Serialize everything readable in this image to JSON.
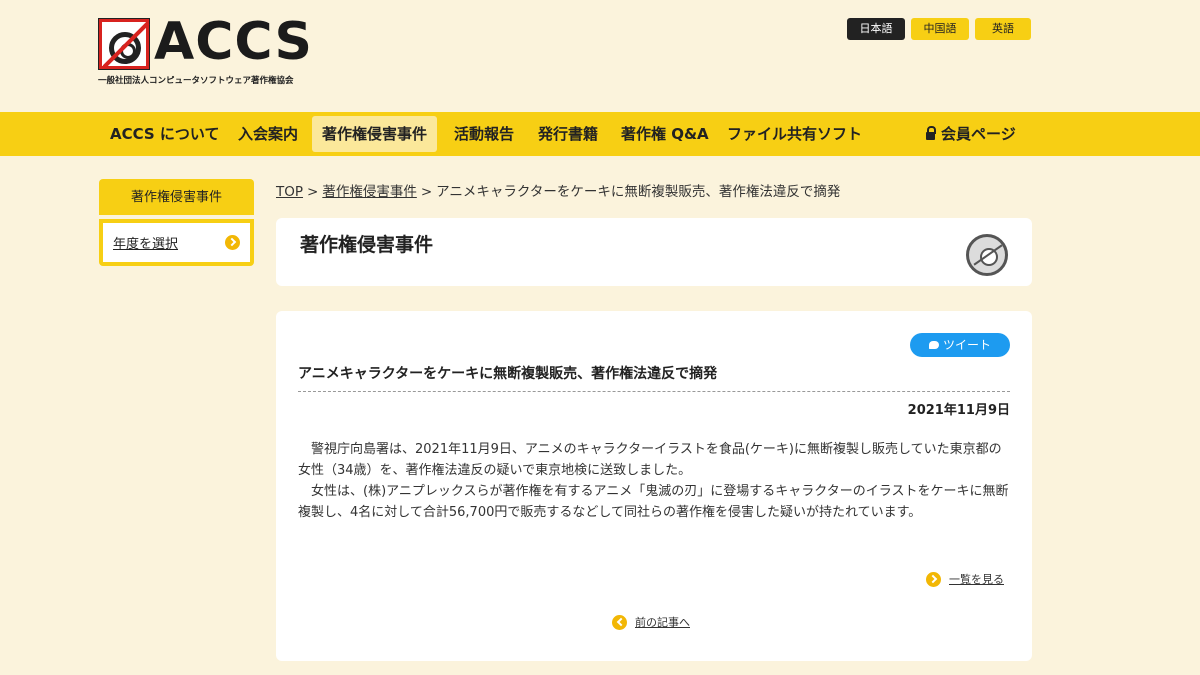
{
  "header": {
    "logo_text": "ACCS",
    "logo_subtitle": "一般社団法人コンピュータソフトウェア著作権協会",
    "languages": [
      {
        "label": "日本語",
        "active": true
      },
      {
        "label": "中国語",
        "active": false
      },
      {
        "label": "英語",
        "active": false
      }
    ]
  },
  "nav": {
    "items": [
      "ACCS について",
      "入会案内",
      "著作権侵害事件",
      "活動報告",
      "発行書籍",
      "著作権 Q&A",
      "ファイル共有ソフト"
    ],
    "active_index": 2,
    "members_label": "会員ページ"
  },
  "sidebar": {
    "heading": "著作権侵害事件",
    "link_label": "年度を選択"
  },
  "breadcrumb": {
    "items": [
      "TOP",
      "著作権侵害事件",
      "アニメキャラクターをケーキに無断複製販売、著作権法違反で摘発"
    ],
    "separator": ">"
  },
  "section_title": "著作権侵害事件",
  "article": {
    "tweet_label": "ツイート",
    "title": "アニメキャラクターをケーキに無断複製販売、著作権法違反で摘発",
    "date": "2021年11月9日",
    "paragraphs": [
      "警視庁向島署は、2021年11月9日、アニメのキャラクターイラストを食品(ケーキ)に無断複製し販売していた東京都の女性（34歳）を、著作権法違反の疑いで東京地検に送致しました。",
      "女性は、(株)アニプレックスらが著作権を有するアニメ「鬼滅の刃」に登場するキャラクターのイラストをケーキに無断複製し、4名に対して合計56,700円で販売するなどして同社らの著作権を侵害した疑いが持たれています。"
    ],
    "list_link": "一覧を見る",
    "prev_link": "前の記事へ"
  },
  "colors": {
    "background": "#fbf3dc",
    "accent_yellow": "#f7cf14",
    "tweet_blue": "#1d9bf0"
  }
}
